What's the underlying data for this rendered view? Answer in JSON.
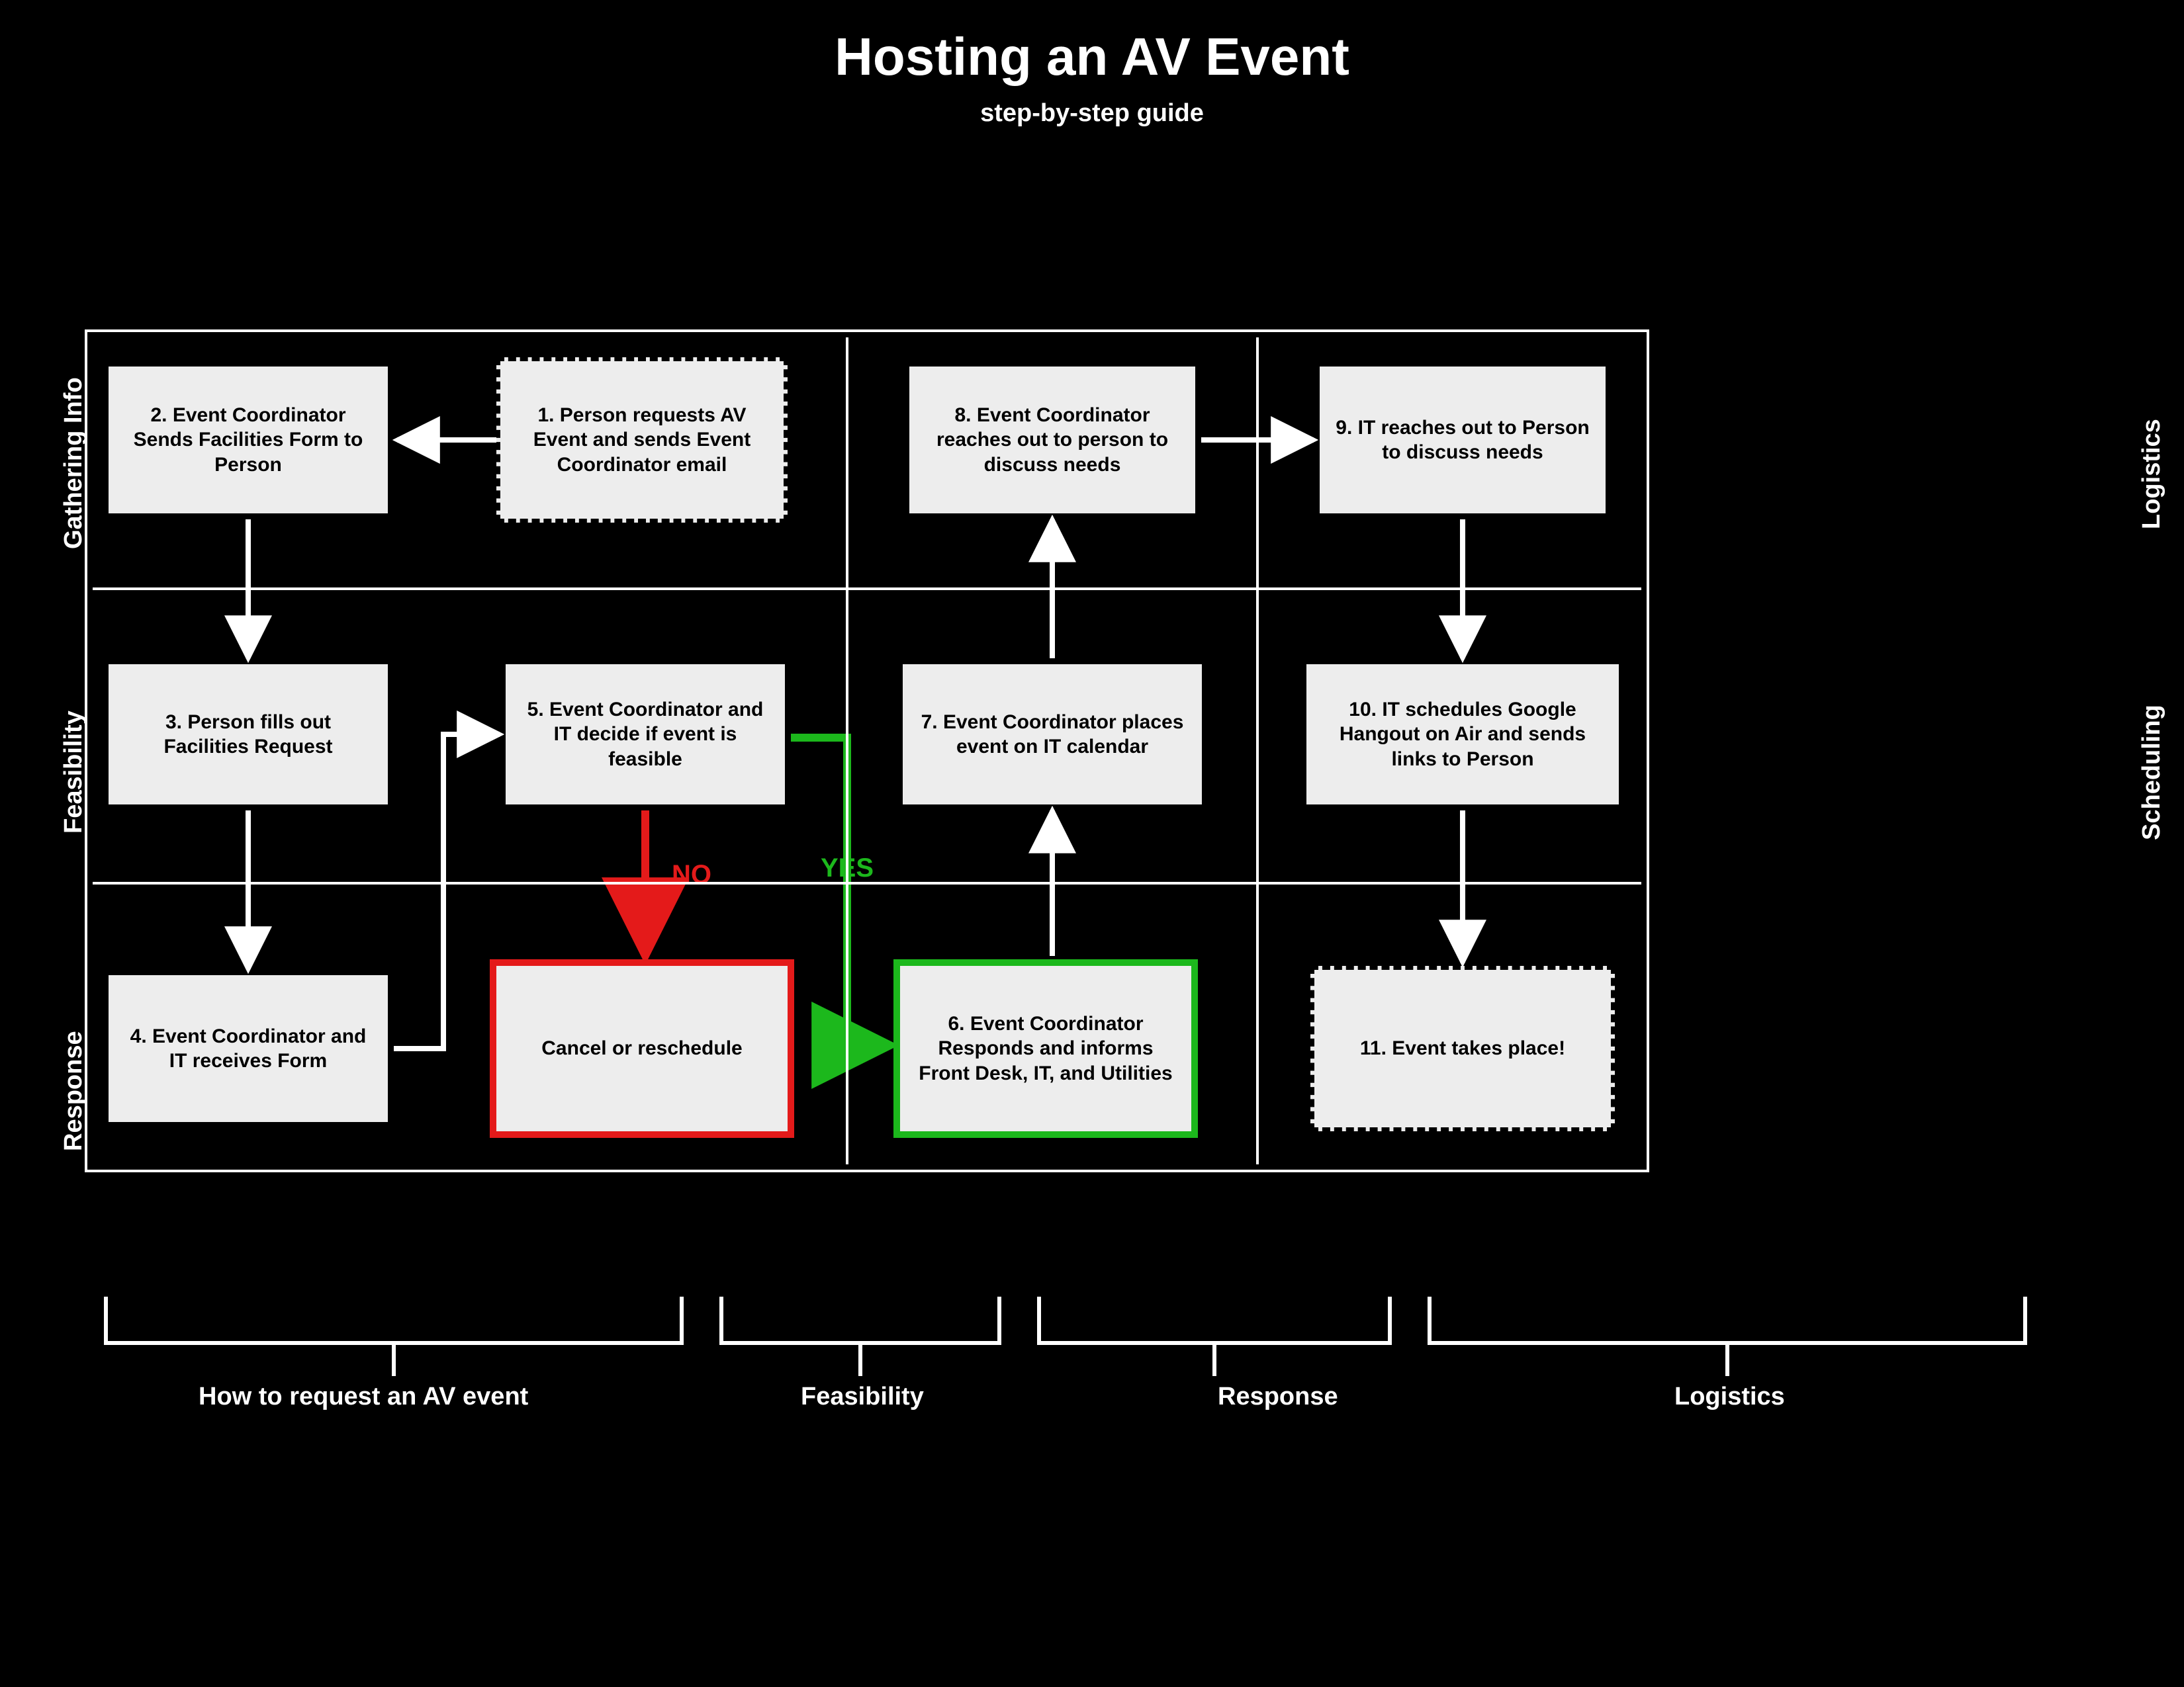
{
  "title": "Hosting an AV Event",
  "subtitle": "step-by-step guide",
  "side_labels": {
    "a": "Gathering Info",
    "b": "Feasibility",
    "c": "Response",
    "d": "Logistics",
    "e": "Scheduling"
  },
  "nodes": {
    "n1": "1. Person requests AV Event and sends Event Coordinator email",
    "n2": "2. Event Coordinator Sends Facilities Form to Person",
    "n3": "3. Person fills out Facilities Request",
    "n4": "4. Event Coordinator and IT receives Form",
    "n5": "5. Event Coordinator and  IT decide if event is feasible",
    "n6": "6. Event Coordinator Responds and informs Front Desk, IT, and Utilities",
    "n7": "7. Event Coordinator places event on IT calendar",
    "n8": "8. Event Coordinator reaches out to  person to discuss needs",
    "n9": "9. IT reaches out to Person to discuss needs",
    "n10": "10. IT schedules Google Hangout on Air and sends links to Person",
    "n11": "11. Event takes place!",
    "nC": "Cancel or reschedule"
  },
  "labels": {
    "yes": "YES",
    "no": "NO"
  },
  "footers": {
    "f1": "How to request an AV event",
    "f2": "Feasibility",
    "f3": "Response",
    "f4": "Logistics"
  },
  "colors": {
    "red": "#e41a1a",
    "green": "#1cb81c",
    "bg": "#000000",
    "node": "#ededed"
  }
}
